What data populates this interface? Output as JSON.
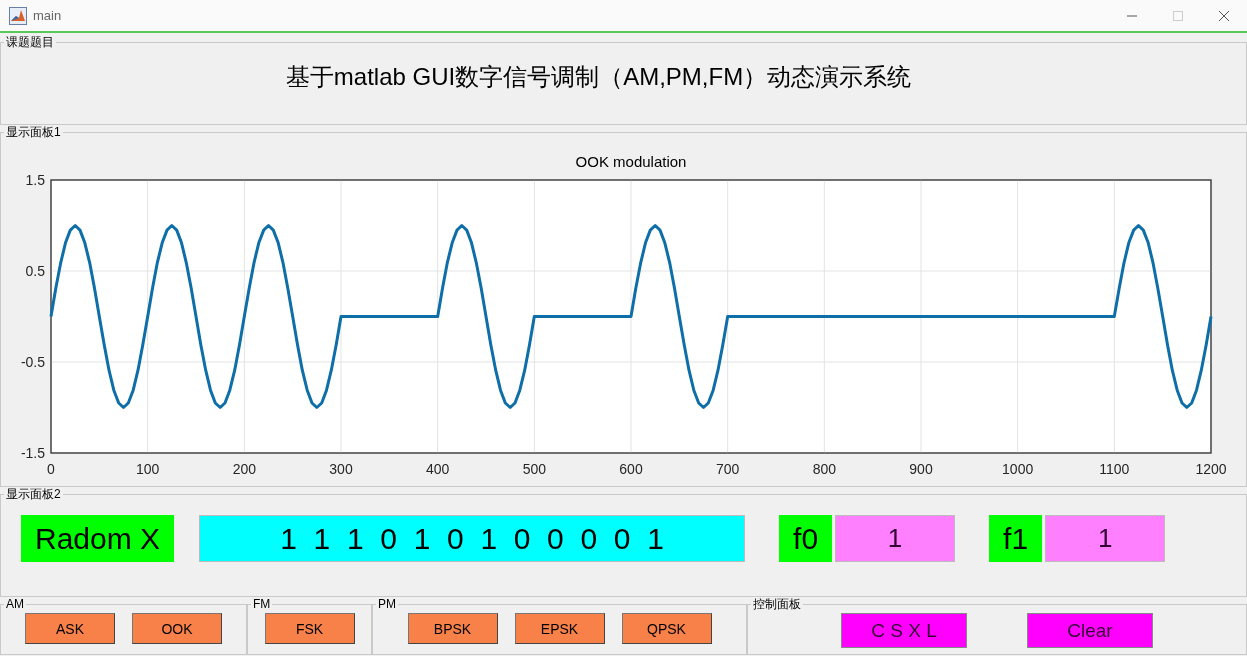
{
  "window": {
    "title": "main"
  },
  "title_panel": {
    "label": "课题题目",
    "heading": "基于matlab GUI数字信号调制（AM,PM,FM）动态演示系统"
  },
  "display_panel_1": {
    "label": "显示面板1",
    "chart_data": {
      "type": "line",
      "title": "OOK modulation",
      "xlim": [
        0,
        1200
      ],
      "ylim": [
        -1.5,
        1.5
      ],
      "xticks": [
        0,
        100,
        200,
        300,
        400,
        500,
        600,
        700,
        800,
        900,
        1000,
        1100,
        1200
      ],
      "yticks": [
        -1.5,
        -0.5,
        0.5,
        1.5
      ],
      "grid": true,
      "x": [
        0,
        5,
        10,
        15,
        20,
        25,
        30,
        35,
        40,
        45,
        50,
        55,
        60,
        65,
        70,
        75,
        80,
        85,
        90,
        95,
        100,
        105,
        110,
        115,
        120,
        125,
        130,
        135,
        140,
        145,
        150,
        155,
        160,
        165,
        170,
        175,
        180,
        185,
        190,
        195,
        200,
        205,
        210,
        215,
        220,
        225,
        230,
        235,
        240,
        245,
        250,
        255,
        260,
        265,
        270,
        275,
        280,
        285,
        290,
        295,
        300,
        305,
        310,
        315,
        320,
        325,
        330,
        335,
        340,
        345,
        350,
        355,
        360,
        365,
        370,
        375,
        380,
        385,
        390,
        395,
        400,
        405,
        410,
        415,
        420,
        425,
        430,
        435,
        440,
        445,
        450,
        455,
        460,
        465,
        470,
        475,
        480,
        485,
        490,
        495,
        500,
        505,
        510,
        515,
        520,
        525,
        530,
        535,
        540,
        545,
        550,
        555,
        560,
        565,
        570,
        575,
        580,
        585,
        590,
        595,
        600,
        605,
        610,
        615,
        620,
        625,
        630,
        635,
        640,
        645,
        650,
        655,
        660,
        665,
        670,
        675,
        680,
        685,
        690,
        695,
        700,
        705,
        710,
        715,
        720,
        725,
        730,
        735,
        740,
        745,
        750,
        755,
        760,
        765,
        770,
        775,
        780,
        785,
        790,
        795,
        800,
        805,
        810,
        815,
        820,
        825,
        830,
        835,
        840,
        845,
        850,
        855,
        860,
        865,
        870,
        875,
        880,
        885,
        890,
        895,
        900,
        905,
        910,
        915,
        920,
        925,
        930,
        935,
        940,
        945,
        950,
        955,
        960,
        965,
        970,
        975,
        980,
        985,
        990,
        995,
        1000,
        1005,
        1010,
        1015,
        1020,
        1025,
        1030,
        1035,
        1040,
        1045,
        1050,
        1055,
        1060,
        1065,
        1070,
        1075,
        1080,
        1085,
        1090,
        1095,
        1100,
        1105,
        1110,
        1115,
        1120,
        1125,
        1130,
        1135,
        1140,
        1145,
        1150,
        1155,
        1160,
        1165,
        1170,
        1175,
        1180,
        1185,
        1190,
        1195,
        1200
      ],
      "series": [
        {
          "color": "#0e6fa8",
          "values": [
            0,
            0.31,
            0.59,
            0.81,
            0.95,
            1,
            0.95,
            0.81,
            0.59,
            0.31,
            0,
            -0.31,
            -0.59,
            -0.81,
            -0.95,
            -1,
            -0.95,
            -0.81,
            -0.59,
            -0.31,
            0,
            0.31,
            0.59,
            0.81,
            0.95,
            1,
            0.95,
            0.81,
            0.59,
            0.31,
            0,
            -0.31,
            -0.59,
            -0.81,
            -0.95,
            -1,
            -0.95,
            -0.81,
            -0.59,
            -0.31,
            0,
            0.31,
            0.59,
            0.81,
            0.95,
            1,
            0.95,
            0.81,
            0.59,
            0.31,
            0,
            -0.31,
            -0.59,
            -0.81,
            -0.95,
            -1,
            -0.95,
            -0.81,
            -0.59,
            -0.31,
            0,
            0,
            0,
            0,
            0,
            0,
            0,
            0,
            0,
            0,
            0,
            0,
            0,
            0,
            0,
            0,
            0,
            0,
            0,
            0,
            0,
            0.31,
            0.59,
            0.81,
            0.95,
            1,
            0.95,
            0.81,
            0.59,
            0.31,
            0,
            -0.31,
            -0.59,
            -0.81,
            -0.95,
            -1,
            -0.95,
            -0.81,
            -0.59,
            -0.31,
            0,
            0,
            0,
            0,
            0,
            0,
            0,
            0,
            0,
            0,
            0,
            0,
            0,
            0,
            0,
            0,
            0,
            0,
            0,
            0,
            0,
            0.31,
            0.59,
            0.81,
            0.95,
            1,
            0.95,
            0.81,
            0.59,
            0.31,
            0,
            -0.31,
            -0.59,
            -0.81,
            -0.95,
            -1,
            -0.95,
            -0.81,
            -0.59,
            -0.31,
            0,
            0,
            0,
            0,
            0,
            0,
            0,
            0,
            0,
            0,
            0,
            0,
            0,
            0,
            0,
            0,
            0,
            0,
            0,
            0,
            0,
            0,
            0,
            0,
            0,
            0,
            0,
            0,
            0,
            0,
            0,
            0,
            0,
            0,
            0,
            0,
            0,
            0,
            0,
            0,
            0,
            0,
            0,
            0,
            0,
            0,
            0,
            0,
            0,
            0,
            0,
            0,
            0,
            0,
            0,
            0,
            0,
            0,
            0,
            0,
            0,
            0,
            0,
            0,
            0,
            0,
            0,
            0,
            0,
            0,
            0,
            0,
            0,
            0,
            0,
            0,
            0,
            0,
            0,
            0,
            0,
            0.31,
            0.59,
            0.81,
            0.95,
            1,
            0.95,
            0.81,
            0.59,
            0.31,
            0,
            -0.31,
            -0.59,
            -0.81,
            -0.95,
            -1,
            -0.95,
            -0.81,
            -0.59,
            -0.31,
            0
          ]
        }
      ]
    }
  },
  "display_panel_2": {
    "label": "显示面板2",
    "fields": [
      {
        "kind": "label",
        "text": "Radom X"
      },
      {
        "kind": "display",
        "text": "1  1  1  0  1  0  1  0  0  0  0  1"
      },
      {
        "kind": "label",
        "text": "f0"
      },
      {
        "kind": "input",
        "text": "1"
      },
      {
        "kind": "label",
        "text": "f1"
      },
      {
        "kind": "input",
        "text": "1"
      }
    ]
  },
  "button_groups": [
    {
      "kind": "modulation",
      "label": "AM",
      "buttons": [
        "ASK",
        "OOK"
      ]
    },
    {
      "kind": "modulation",
      "label": "FM",
      "buttons": [
        "FSK"
      ]
    },
    {
      "kind": "modulation",
      "label": "PM",
      "buttons": [
        "BPSK",
        "EPSK",
        "QPSK"
      ]
    },
    {
      "kind": "control",
      "label": "控制面板",
      "buttons": [
        "C S X L",
        "Clear"
      ]
    }
  ]
}
